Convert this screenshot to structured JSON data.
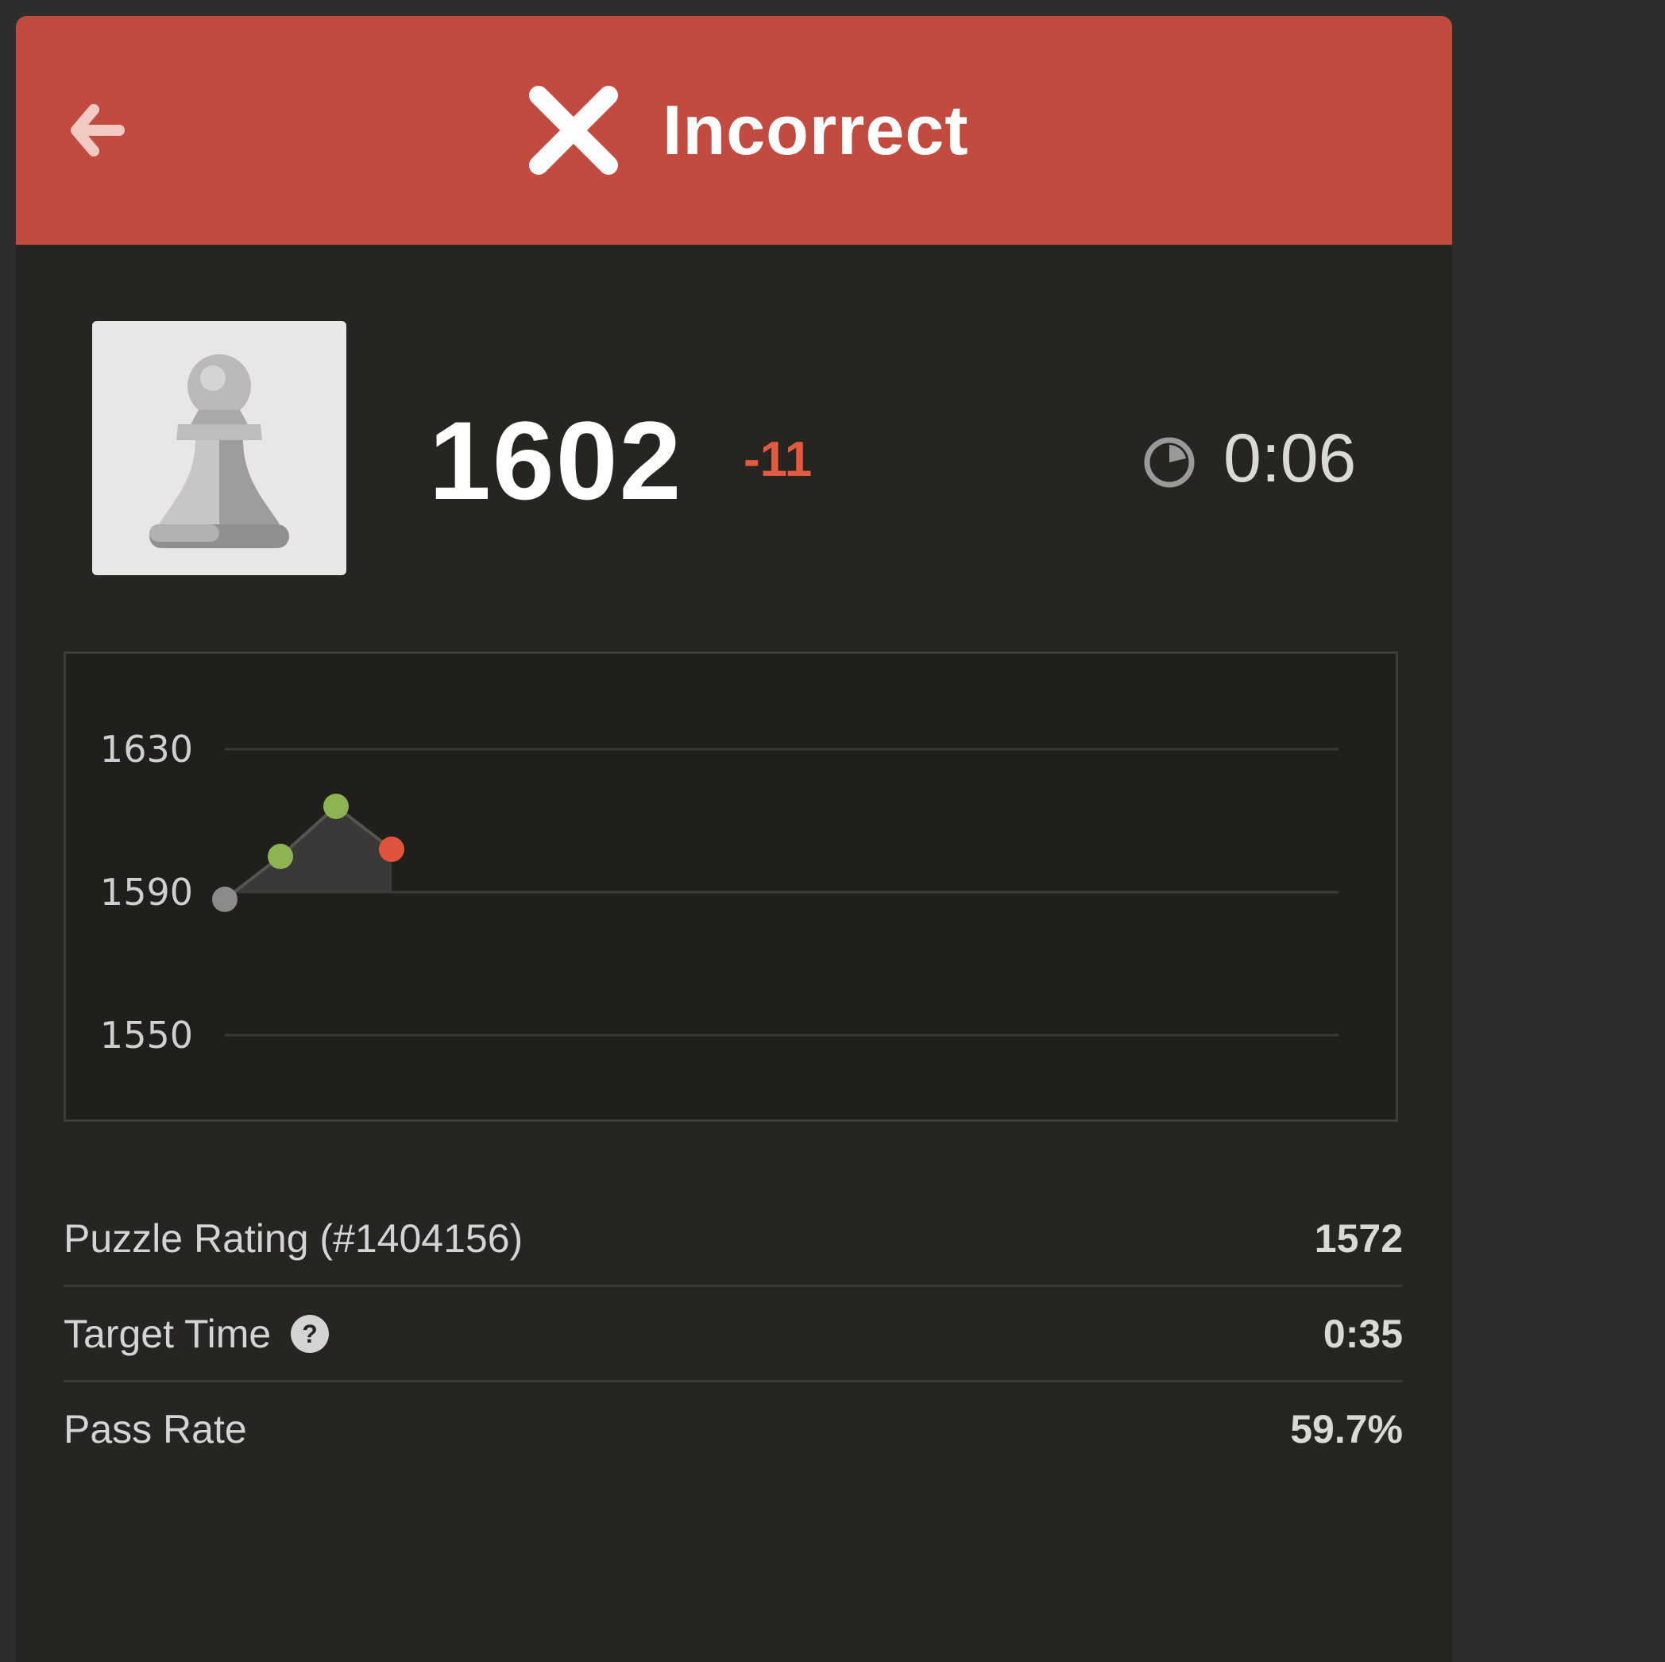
{
  "header": {
    "title": "Incorrect",
    "status": "incorrect",
    "bg_color": "#c04b3e"
  },
  "icons": {
    "back": "arrow-left-icon",
    "status": "x-icon",
    "timer": "timer-icon",
    "help": "help-circle-icon",
    "avatar": "pawn-icon"
  },
  "rating": {
    "value": "1602",
    "delta": "-11",
    "delta_color": "#e25a40"
  },
  "timer": {
    "elapsed": "0:06"
  },
  "chart_data": {
    "type": "line",
    "title": "",
    "xlabel": "",
    "ylabel": "",
    "ylim": [
      1550,
      1630
    ],
    "y_ticks": [
      "1630",
      "1590",
      "1550"
    ],
    "x": [
      1,
      2,
      3,
      4
    ],
    "series": [
      {
        "values": [
          1588,
          1600,
          1614,
          1602
        ]
      }
    ],
    "point_status": [
      "start",
      "correct",
      "correct",
      "incorrect"
    ],
    "point_colors": {
      "start": "#8b8b89",
      "correct": "#8db352",
      "incorrect": "#e0533d"
    },
    "grid": true,
    "area_fill": true
  },
  "stats": [
    {
      "label": "Puzzle Rating (#1404156)",
      "value": "1572"
    },
    {
      "label": "Target Time",
      "value": "0:35",
      "has_help": true
    },
    {
      "label": "Pass Rate",
      "value": "59.7%"
    }
  ]
}
